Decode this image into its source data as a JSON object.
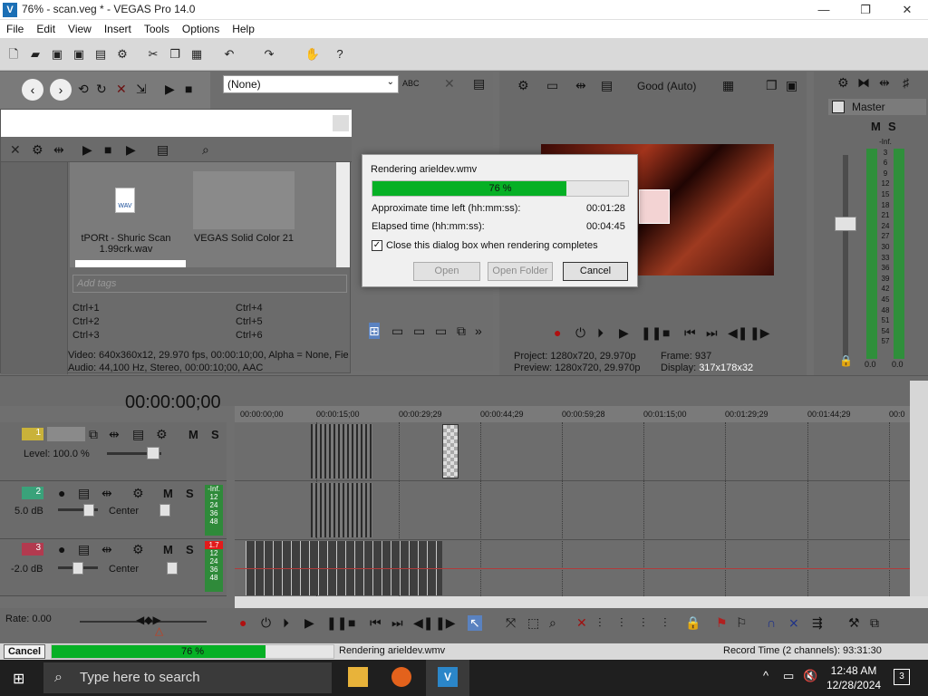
{
  "window": {
    "title": "76% - scan.veg * - VEGAS Pro 14.0",
    "minimize": "—",
    "maximize": "❐",
    "close": "✕"
  },
  "menu": [
    "File",
    "Edit",
    "View",
    "Insert",
    "Tools",
    "Options",
    "Help"
  ],
  "media": {
    "dropdown_value": "(None)",
    "items": [
      {
        "name": "tPORt - Shuric Scan 1.99crk.wav",
        "badge": "WAV"
      },
      {
        "name": "VEGAS Solid Color 21"
      }
    ],
    "tags_placeholder": "Add tags",
    "shortcuts_left": [
      "Ctrl+1",
      "Ctrl+2",
      "Ctrl+3"
    ],
    "shortcuts_right": [
      "Ctrl+4",
      "Ctrl+5",
      "Ctrl+6"
    ],
    "video_info": "Video: 640x360x12, 29.970 fps, 00:00:10;00, Alpha = None, Fie",
    "audio_info": "Audio: 44,100 Hz, Stereo, 00:00:10;00, AAC"
  },
  "render_dialog": {
    "title": "Rendering arieldev.wmv",
    "progress_label": "76 %",
    "progress": 0.76,
    "time_left_label": "Approximate time left (hh:mm:ss):",
    "time_left": "00:01:28",
    "elapsed_label": "Elapsed time (hh:mm:ss):",
    "elapsed": "00:04:45",
    "close_checkbox": "Close this dialog box when rendering completes",
    "open_button": "Open",
    "open_folder_button": "Open Folder",
    "cancel_button": "Cancel"
  },
  "preview": {
    "quality": "Good (Auto)",
    "project_label": "Project:",
    "project": "1280x720, 29.970p",
    "preview_label": "Preview:",
    "preview": "1280x720, 29.970p",
    "frame_label": "Frame:",
    "frame": "937",
    "display_label": "Display:",
    "display": "317x178x32"
  },
  "master": {
    "title": "Master",
    "mute": "M",
    "solo": "S",
    "scale": [
      "-Inf.",
      "3",
      "6",
      "9",
      "12",
      "15",
      "18",
      "21",
      "24",
      "27",
      "30",
      "33",
      "36",
      "39",
      "42",
      "45",
      "48",
      "51",
      "54",
      "57"
    ],
    "left_value": "0.0",
    "right_value": "0.0"
  },
  "timeline": {
    "timecode": "00:00:00;00",
    "ruler": [
      "00:00:00;00",
      "00:00:15;00",
      "00:00:29;29",
      "00:00:44;29",
      "00:00:59;28",
      "00:01:15;00",
      "00:01:29;29",
      "00:01:44;29",
      "00:0"
    ],
    "tracks": [
      {
        "num": "1",
        "level_label": "Level: 100.0 %",
        "color": "#c9b23a"
      },
      {
        "num": "2",
        "db": "5.0 dB",
        "pan": "Center",
        "meter": [
          "-Inf.",
          "12",
          "24",
          "36",
          "48"
        ],
        "color": "#3aa27a"
      },
      {
        "num": "3",
        "db": "-2.0 dB",
        "pan": "Center",
        "meter": [
          "1.7",
          "12",
          "24",
          "36",
          "48"
        ],
        "color": "#b23a4f"
      }
    ],
    "mute": "M",
    "solo": "S",
    "rate_label": "Rate: 0.00"
  },
  "status": {
    "cancel_button": "Cancel",
    "progress_label": "76 %",
    "progress": 0.76,
    "rendering_text": "Rendering arieldev.wmv",
    "record_time": "Record Time (2 channels): 93:31:30"
  },
  "taskbar": {
    "search_placeholder": "Type here to search",
    "time": "12:48 AM",
    "date": "12/28/2024",
    "notifications": "3"
  }
}
